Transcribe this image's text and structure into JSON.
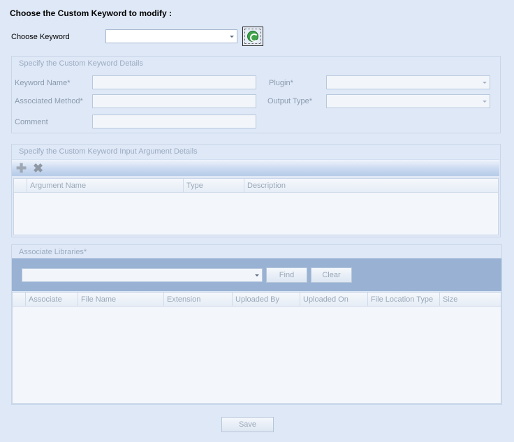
{
  "header": {
    "title": "Choose the Custom Keyword to modify :"
  },
  "choose": {
    "label": "Choose Keyword",
    "value": ""
  },
  "details": {
    "title": "Specify the Custom Keyword Details",
    "keyword_name_label": "Keyword Name*",
    "keyword_name_value": "",
    "associated_method_label": "Associated Method*",
    "associated_method_value": "",
    "comment_label": "Comment",
    "comment_value": "",
    "plugin_label": "Plugin*",
    "plugin_value": "",
    "output_type_label": "Output Type*",
    "output_type_value": ""
  },
  "arguments": {
    "title": "Specify the Custom Keyword Input Argument Details",
    "columns": [
      "Argument Name",
      "Type",
      "Description"
    ],
    "rows": []
  },
  "libraries": {
    "title": "Associate Libraries*",
    "find_label": "Find",
    "clear_label": "Clear",
    "library_value": "",
    "columns": [
      "Associate",
      "File Name",
      "Extension",
      "Uploaded By",
      "Uploaded On",
      "File Location Type",
      "Size"
    ],
    "rows": []
  },
  "footer": {
    "save_label": "Save"
  },
  "icons": {
    "refresh": "refresh-icon",
    "add": "add-icon",
    "delete": "delete-icon"
  },
  "colors": {
    "background": "#dfe8f6",
    "toolbar_band": "#99b2d4",
    "disabled_text": "#9aabc2"
  }
}
